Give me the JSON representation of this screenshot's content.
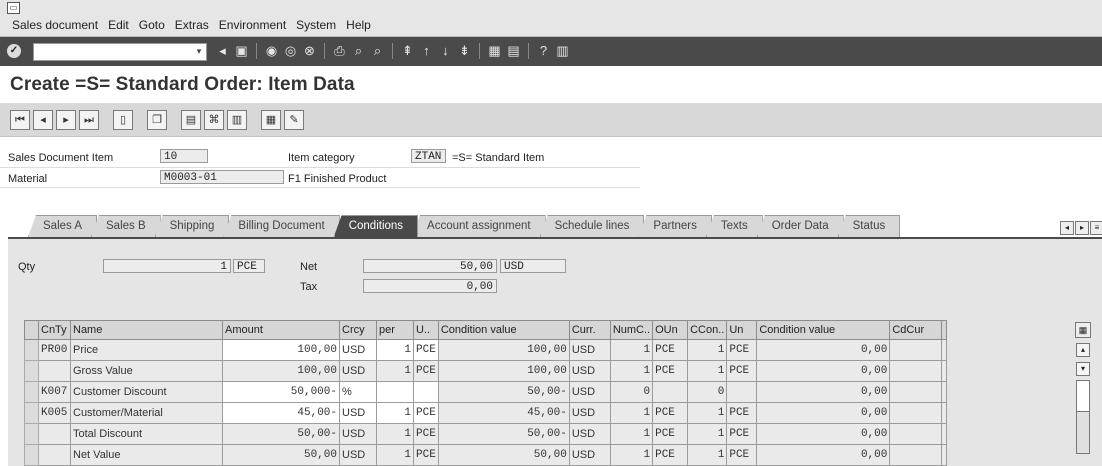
{
  "menu": {
    "items": [
      "Sales document",
      "Edit",
      "Goto",
      "Extras",
      "Environment",
      "System",
      "Help"
    ]
  },
  "toolbar": {
    "command_value": ""
  },
  "title": "Create =S= Standard Order: Item Data",
  "header": {
    "sales_doc_item_label": "Sales Document Item",
    "sales_doc_item_value": "10",
    "item_category_label": "Item category",
    "item_category_value": "ZTAN",
    "item_category_text": "=S= Standard Item",
    "material_label": "Material",
    "material_value": "M0003-01",
    "material_text": "F1 Finished Product"
  },
  "tabs": [
    "Sales A",
    "Sales B",
    "Shipping",
    "Billing Document",
    "Conditions",
    "Account assignment",
    "Schedule lines",
    "Partners",
    "Texts",
    "Order Data",
    "Status"
  ],
  "active_tab": "Conditions",
  "conditions": {
    "qty_label": "Qty",
    "qty_value": "1",
    "qty_unit": "PCE",
    "net_label": "Net",
    "net_value": "50,00",
    "net_currency": "USD",
    "tax_label": "Tax",
    "tax_value": "0,00"
  },
  "table": {
    "headers": [
      "CnTy",
      "Name",
      "Amount",
      "Crcy",
      "per",
      "U..",
      "Condition value",
      "Curr.",
      "NumC..",
      "OUn",
      "CCon..",
      "Un",
      "Condition value",
      "CdCur"
    ],
    "rows": [
      [
        "PR00",
        "Price",
        "100,00",
        "USD",
        "1",
        "PCE",
        "100,00",
        "USD",
        "1",
        "PCE",
        "1",
        "PCE",
        "0,00",
        ""
      ],
      [
        "",
        "Gross Value",
        "100,00",
        "USD",
        "1",
        "PCE",
        "100,00",
        "USD",
        "1",
        "PCE",
        "1",
        "PCE",
        "0,00",
        ""
      ],
      [
        "K007",
        "Customer Discount",
        "50,000-",
        "%",
        "",
        "",
        "50,00-",
        "USD",
        "0",
        "",
        "0",
        "",
        "0,00",
        ""
      ],
      [
        "K005",
        "Customer/Material",
        "45,00-",
        "USD",
        "1",
        "PCE",
        "45,00-",
        "USD",
        "1",
        "PCE",
        "1",
        "PCE",
        "0,00",
        ""
      ],
      [
        "",
        "Total Discount",
        "50,00-",
        "USD",
        "1",
        "PCE",
        "50,00-",
        "USD",
        "1",
        "PCE",
        "1",
        "PCE",
        "0,00",
        ""
      ],
      [
        "",
        "Net Value",
        "50,00",
        "USD",
        "1",
        "PCE",
        "50,00",
        "USD",
        "1",
        "PCE",
        "1",
        "PCE",
        "0,00",
        ""
      ]
    ]
  }
}
